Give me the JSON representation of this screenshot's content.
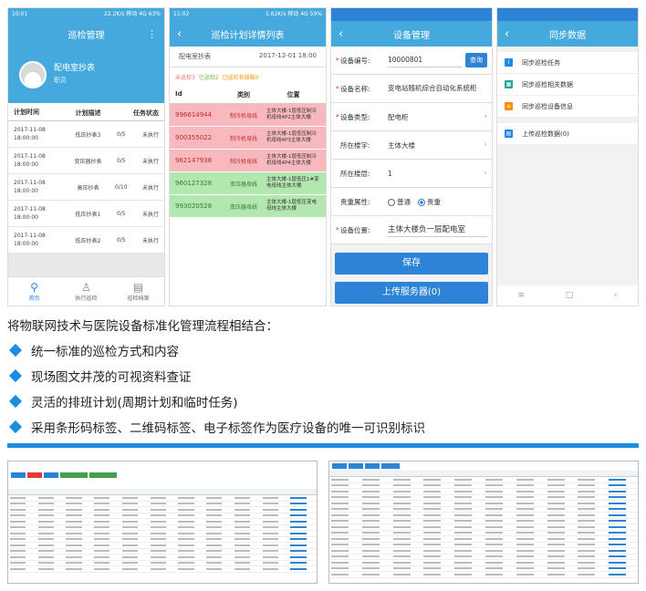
{
  "phone1": {
    "status_left": "10:01",
    "status_right": "22.2K/s 移动 4G 63%",
    "title": "巡检管理",
    "user_name": "配电室抄表",
    "user_role": "职员",
    "headers": [
      "计划时间",
      "计划描述",
      "",
      "任务状态"
    ],
    "rows": [
      {
        "time": "2017-11-08 18:00:00",
        "desc": "低压抄表3",
        "count": "0/5",
        "status": "未执行"
      },
      {
        "time": "2017-11-08 18:00:00",
        "desc": "变压器抄表",
        "count": "0/5",
        "status": "未执行"
      },
      {
        "time": "2017-11-08 18:00:00",
        "desc": "高压抄表",
        "count": "0/10",
        "status": "未执行"
      },
      {
        "time": "2017-11-08 18:00:00",
        "desc": "低压抄表1",
        "count": "0/5",
        "status": "未执行"
      },
      {
        "time": "2017-11-08 18:00:00",
        "desc": "低压抄表2",
        "count": "0/5",
        "status": "未执行"
      }
    ],
    "tabs": [
      "首页",
      "执行巡检",
      "巡检档案"
    ]
  },
  "phone2": {
    "status_left": "11:02",
    "status_right": "1.62K/s 移动 4G 59%",
    "title": "巡检计划详情列表",
    "sub_left": "配电室抄表",
    "sub_right": "2017-12-01 18:00",
    "legend": [
      "未巡检3",
      "已巡检2",
      "已巡检有缺陷0"
    ],
    "headers": [
      "Id",
      "类别",
      "位置"
    ],
    "rows": [
      {
        "id": "996614944",
        "type": "制冷机母线",
        "pos": "主体大楼-1层低压制冷机母线4P2主体大楼",
        "color": "red"
      },
      {
        "id": "900355022",
        "type": "制冷机母线",
        "pos": "主体大楼-1层低压制冷机母线4P3主体大楼",
        "color": "red"
      },
      {
        "id": "962147938",
        "type": "制冷机母线",
        "pos": "主体大楼-1层低压制冷机母线4P4主体大楼",
        "color": "red"
      },
      {
        "id": "960127328",
        "type": "变压器母线",
        "pos": "主体大楼-1层低压1#变电母线主体大楼",
        "color": "green"
      },
      {
        "id": "993020528",
        "type": "变压器母线",
        "pos": "主体大楼-1层低压变电母线主体大楼",
        "color": "green"
      }
    ]
  },
  "phone3": {
    "title": "设备管理",
    "fields": {
      "code_label": "设备编号:",
      "code_value": "10000801",
      "query": "查询",
      "name_label": "设备名称:",
      "name_value": "变电站随机综合自动化系统柜",
      "type_label": "设备类型:",
      "type_value": "配电柜",
      "building_label": "所在楼宇:",
      "building_value": "主体大楼",
      "floor_label": "所在楼层:",
      "floor_value": "1",
      "attr_label": "贵重属性:",
      "attr_normal": "普通",
      "attr_valuable": "贵重",
      "loc_label": "设备位置:",
      "loc_value": "主体大楼负一层配电室"
    },
    "save": "保存",
    "upload": "上传服务器(0)"
  },
  "phone4": {
    "title": "同步数据",
    "items": [
      "同步巡检任务",
      "同步巡检相关数据",
      "同步巡检设备信息",
      "上传巡检数据(0)"
    ],
    "item_colors": [
      "#1e88e5",
      "#26a69a",
      "#fb8c00",
      "#1e88e5"
    ]
  },
  "intro": "将物联网技术与医院设备标准化管理流程相结合：",
  "bullets": [
    "统一标准的巡检方式和内容",
    "现场图文并茂的可视资料查证",
    "灵活的排班计划(周期计划和临时任务)",
    "采用条形码标签、二维码标签、电子标签作为医疗设备的唯一可识别标识"
  ]
}
